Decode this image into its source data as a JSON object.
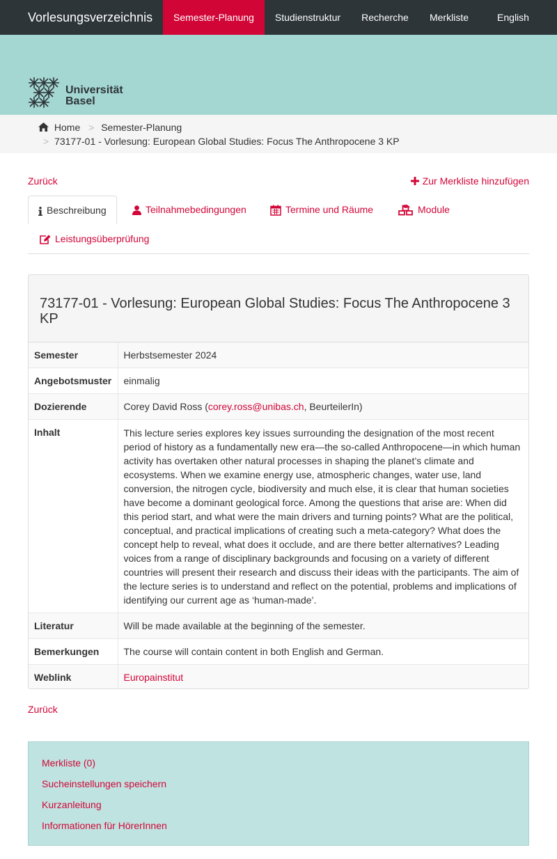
{
  "nav": {
    "brand": "Vorlesungsverzeichnis",
    "items": [
      "Semester-Planung",
      "Studienstruktur",
      "Recherche",
      "Merkliste"
    ],
    "language": "English"
  },
  "logo": {
    "line1": "Universität",
    "line2": "Basel"
  },
  "breadcrumb": {
    "home": "Home",
    "separator": ">",
    "level1": "Semester-Planung",
    "current": "73177-01 - Vorlesung: European Global Studies: Focus The Anthropocene 3 KP"
  },
  "actions": {
    "back": "Zurück",
    "add_to_list": "Zur Merkliste hinzufügen"
  },
  "tabs": [
    {
      "label": "Beschreibung",
      "icon": "info-icon"
    },
    {
      "label": "Teilnahmebedingungen",
      "icon": "user-icon"
    },
    {
      "label": "Termine und Räume",
      "icon": "calendar-icon"
    },
    {
      "label": "Module",
      "icon": "cubes-icon"
    },
    {
      "label": "Leistungsüberprüfung",
      "icon": "edit-icon"
    }
  ],
  "course": {
    "title": "73177-01 - Vorlesung: European Global Studies: Focus The Anthropocene 3 KP",
    "rows": {
      "semester": {
        "label": "Semester",
        "value": "Herbstsemester 2024"
      },
      "angebot": {
        "label": "Angebotsmuster",
        "value": "einmalig"
      },
      "dozierende": {
        "label": "Dozierende",
        "name": "Corey David Ross (",
        "email": "corey.ross@unibas.ch",
        "role": ", BeurteilerIn)"
      },
      "inhalt": {
        "label": "Inhalt",
        "value": "This lecture series explores key issues surrounding the designation of the most recent period of history as a fundamentally new era—the so-called Anthropocene—in which human activity has overtaken other natural processes in shaping the planet’s climate and ecosystems. When we examine energy use, atmospheric changes, water use, land conversion, the nitrogen cycle, biodiversity and much else, it is clear that human societies have become a dominant geological force. Among the questions that arise are: When did this period start, and what were the main drivers and turning points? What are the political, conceptual, and practical implications of creating such a meta-category? What does the concept help to reveal, what does it occlude, and are there better alternatives? Leading voices from a range of disciplinary backgrounds and focusing on a variety of different countries will present their research and discuss their ideas with the participants. The aim of the lecture series is to understand and reflect on the potential, problems and implications of identifying our current age as ‘human-made’."
      },
      "literatur": {
        "label": "Literatur",
        "value": "Will be made available at the beginning of the semester."
      },
      "bemerkungen": {
        "label": "Bemerkungen",
        "value": "The course will contain content in both English and German."
      },
      "weblink": {
        "label": "Weblink",
        "value": "Europainstitut"
      }
    }
  },
  "footer": {
    "links": [
      "Merkliste (0)",
      "Sucheinstellungen speichern",
      "Kurzanleitung",
      "Informationen für HörerInnen"
    ]
  },
  "colors": {
    "accent": "#d20537",
    "navbar": "#2d3539",
    "banner": "#a5d7d2",
    "footer": "#bfe3e0"
  }
}
